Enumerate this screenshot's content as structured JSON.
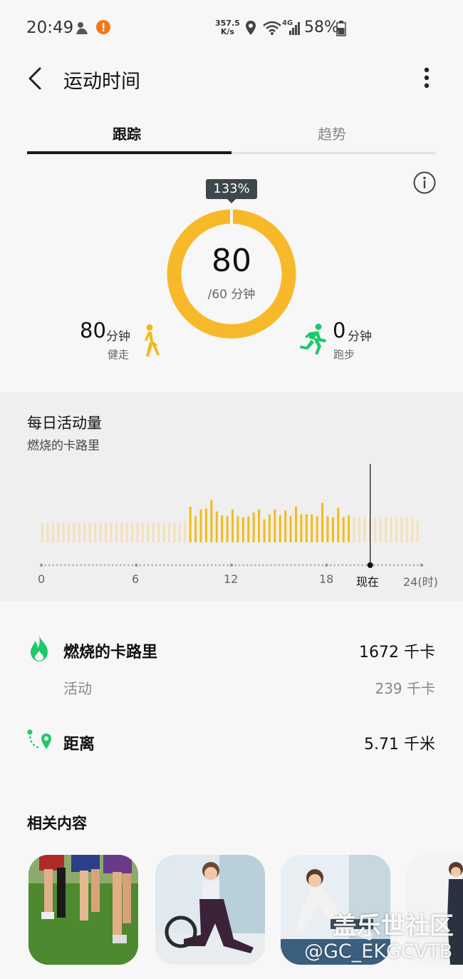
{
  "status_bar": {
    "time": "20:49",
    "net_speed_value": "357.5",
    "net_speed_unit": "K/s",
    "battery": "58%",
    "network_type": "4G"
  },
  "header": {
    "title": "运动时间"
  },
  "tabs": [
    {
      "label": "跟踪",
      "active": true
    },
    {
      "label": "趋势",
      "active": false
    }
  ],
  "summary": {
    "percent_badge": "133%",
    "minutes": "80",
    "goal": "/60 分钟",
    "progress_fraction": 1.33,
    "walking": {
      "value": "80",
      "unit": "分钟",
      "label": "健走"
    },
    "running": {
      "value": "0",
      "unit": "分钟",
      "label": "跑步"
    }
  },
  "activity_chart": {
    "title": "每日活动量",
    "subtitle": "燃烧的卡路里",
    "x_tick_labels": [
      "0",
      "6",
      "12",
      "18",
      "现在",
      "24(时)"
    ]
  },
  "chart_data": {
    "type": "bar",
    "title": "每日活动量",
    "ylabel": "燃烧的卡路里",
    "x_unit": "时",
    "note_now_hour": 20.75,
    "bins_per_hour": 3,
    "bars": [
      2,
      2,
      2,
      2,
      2,
      2,
      2,
      2,
      2,
      2,
      2,
      2,
      2,
      2,
      2,
      2,
      2,
      2,
      2,
      2,
      2,
      2,
      2,
      2,
      2,
      2,
      2,
      2.2,
      3.7,
      2.7,
      3.4,
      3.5,
      4.4,
      3.2,
      2.8,
      2.7,
      3.4,
      2.7,
      2.6,
      2.7,
      3.1,
      3.4,
      2.4,
      2.9,
      3.4,
      2.8,
      3.3,
      2.7,
      3.7,
      2.9,
      2.9,
      2.9,
      2.7,
      4.1,
      2.7,
      2.6,
      3.6,
      2.6,
      2.8,
      2.6,
      2.6,
      2.6,
      2.6,
      2.6,
      2.6,
      2.6,
      2.6,
      2.6,
      2.6,
      2.6,
      2.6,
      2.2
    ],
    "highlight_range": [
      28,
      58
    ],
    "colors": {
      "highlight": "#f5bb14",
      "normal": "#f5dfb8"
    }
  },
  "stats": {
    "calories": {
      "label": "燃烧的卡路里",
      "value": "1672 千卡"
    },
    "active": {
      "label": "活动",
      "value": "239 千卡"
    },
    "distance": {
      "label": "距离",
      "value": "5.71 千米"
    }
  },
  "related": {
    "title": "相关内容",
    "watermark_line1": "盖乐世社区",
    "watermark_line2": "@GC_EKGCVTB"
  },
  "colors": {
    "ring": "#f7b92a",
    "accent_green": "#1ec96a",
    "walk_yellow": "#f5b818",
    "badge_bg": "#3d474c"
  }
}
